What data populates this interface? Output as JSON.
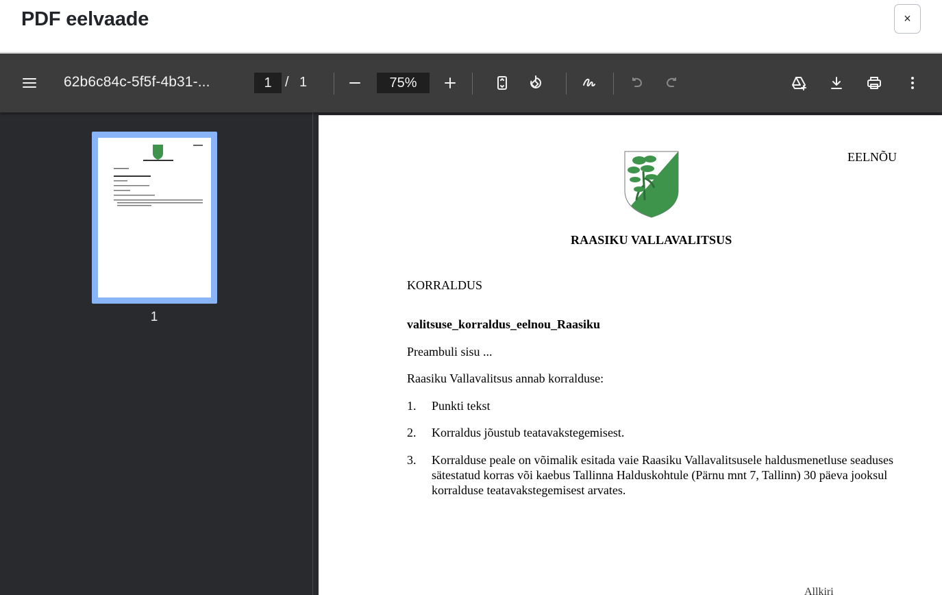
{
  "modal": {
    "title": "PDF eelvaade",
    "close_label": "×"
  },
  "toolbar": {
    "menu_icon": "menu-icon",
    "doc_title": "62b6c84c-5f5f-4b31-...",
    "page_current": "1",
    "page_separator": "/",
    "page_total": "1",
    "zoom": "75%",
    "icons": [
      "menu-icon",
      "zoom-out-icon",
      "zoom-in-icon",
      "fit-page-icon",
      "rotate-icon",
      "annotate-icon",
      "undo-icon",
      "redo-icon",
      "drive-icon",
      "download-icon",
      "print-icon",
      "more-icon"
    ]
  },
  "sidebar": {
    "thumbnails": [
      {
        "label": "1"
      }
    ]
  },
  "document": {
    "draft_label": "EELNÕU",
    "org_name": "RAASIKU VALLAVALITSUS",
    "doc_type": "KORRALDUS",
    "doc_name": "valitsuse_korraldus_eelnou_Raasiku",
    "preamble": "Preambuli sisu ...",
    "intro": "Raasiku Vallavalitsus annab korralduse:",
    "items": [
      {
        "num": "1.",
        "text": "Punkti tekst"
      },
      {
        "num": "2.",
        "text": "Korraldus jõustub teatavakstegemisest."
      },
      {
        "num": "3.",
        "text": "Korralduse peale on võimalik esitada vaie Raasiku Vallavalitsusele haldusmenetluse seaduses sätestatud korras või kaebus Tallinna Halduskohtule (Pärnu mnt 7, Tallinn) 30 päeva jooksul korralduse teatavakstegemisest arvates."
      }
    ],
    "footer_peek": "Allkiri"
  },
  "colors": {
    "toolbar_bg": "#3c3c3c",
    "viewer_bg": "#282a2d",
    "thumb_highlight": "#8ab4f8",
    "crest_green": "#3f944b"
  }
}
